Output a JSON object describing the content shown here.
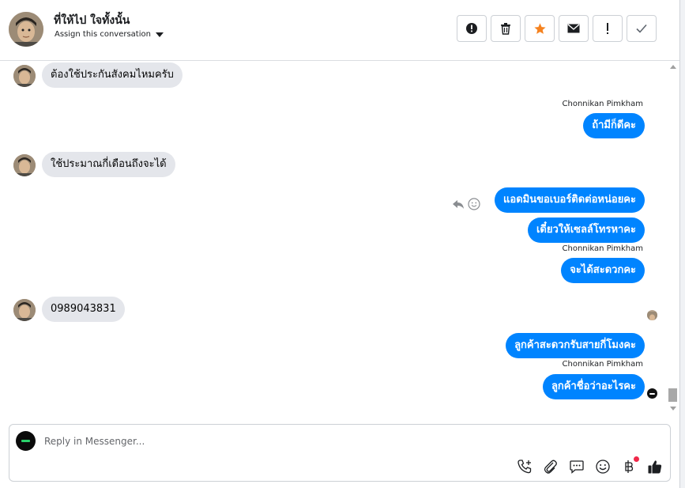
{
  "header": {
    "contact_name": "ที่ให้ไป ใจทั้งนั้น",
    "assign_label": "Assign this conversation",
    "actions": [
      {
        "name": "mark-spam-button",
        "icon": "alert-circle-icon"
      },
      {
        "name": "delete-button",
        "icon": "trash-icon"
      },
      {
        "name": "star-button",
        "icon": "star-icon"
      },
      {
        "name": "mark-unread-button",
        "icon": "envelope-icon"
      },
      {
        "name": "follow-up-button",
        "icon": "exclamation-icon"
      },
      {
        "name": "mark-done-button",
        "icon": "checkmark-icon"
      }
    ]
  },
  "messages": {
    "m1": "ต้องใช้ประกันสังคมไหมครับ",
    "sender1": "Chonnikan Pimkham",
    "m2": "ถ้ามีก็ดีคะ",
    "m3": "ใช้ประมาณกี่เดือนถึงจะได้",
    "m4": "แอดมินขอเบอร์ติดต่อหน่อยคะ",
    "m5": "เดี๋ยวให้เซลล์โทรหาคะ",
    "sender2": "Chonnikan Pimkham",
    "m6": "จะได้สะดวกคะ",
    "m7": "0989043831",
    "m8": "ลูกค้าสะดวกรับสายกี่โมงคะ",
    "sender3": "Chonnikan Pimkham",
    "m9": "ลูกค้าชื่อว่าอะไรคะ"
  },
  "composer": {
    "placeholder": "Reply in Messenger...",
    "tools": [
      "phone-plus-icon",
      "paperclip-icon",
      "saved-reply-icon",
      "emoji-icon",
      "baht-icon",
      "thumbs-up-icon"
    ]
  },
  "colors": {
    "outgoing_bubble": "#0084ff",
    "incoming_bubble": "#e4e6eb",
    "star": "#f5821f",
    "notification": "#f02849"
  }
}
